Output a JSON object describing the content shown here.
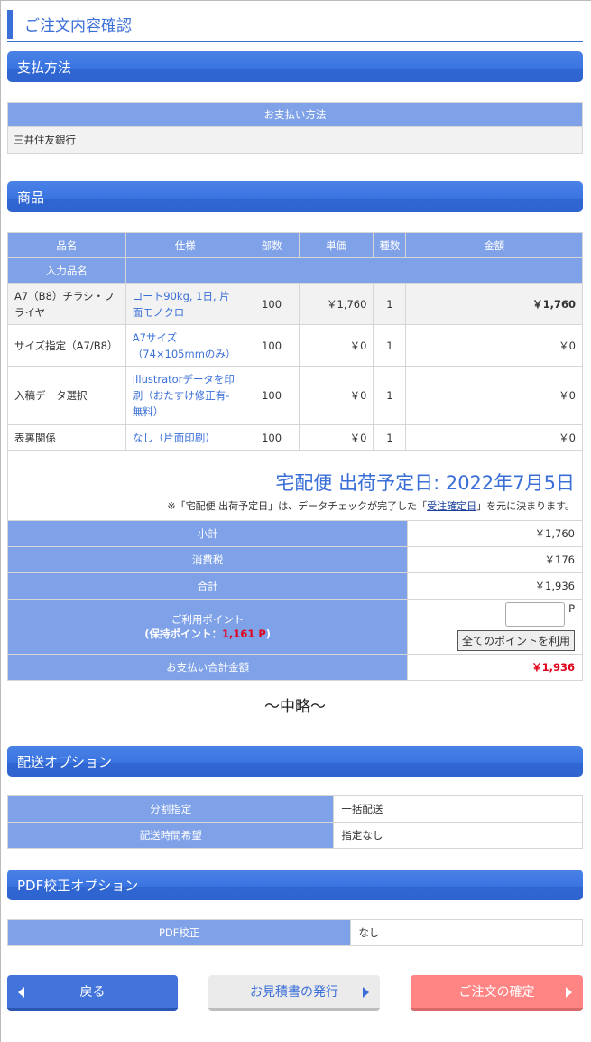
{
  "page_title": "ご注文内容確認",
  "payment": {
    "section_title": "支払方法",
    "header": "お支払い方法",
    "value": "三井住友銀行"
  },
  "products": {
    "section_title": "商品",
    "headers": [
      "品名",
      "仕様",
      "部数",
      "単価",
      "種数",
      "金額"
    ],
    "subheader": "入力品名",
    "rows": [
      {
        "name": "A7（B8）チラシ・フライヤー",
        "spec": "コート90kg, 1日, 片面モノクロ",
        "qty": "100",
        "unit": "￥1,760",
        "kinds": "1",
        "amount": "￥1,760"
      },
      {
        "name": "サイズ指定（A7/B8）",
        "spec": "A7サイズ（74×105mmのみ）",
        "qty": "100",
        "unit": "￥0",
        "kinds": "1",
        "amount": "￥0"
      },
      {
        "name": "入稿データ選択",
        "spec": "Illustratorデータを印刷（おたすけ修正有-無料）",
        "qty": "100",
        "unit": "￥0",
        "kinds": "1",
        "amount": "￥0"
      },
      {
        "name": "表裏関係",
        "spec": "なし（片面印刷）",
        "qty": "100",
        "unit": "￥0",
        "kinds": "1",
        "amount": "￥0"
      }
    ]
  },
  "shipping": {
    "title": "宅配便 出荷予定日: 2022年7月5日",
    "note_before": "※「宅配便 出荷予定日」は、データチェックが完了した「",
    "note_link": "受注確定日",
    "note_after": "」を元に決まります。"
  },
  "summary": {
    "subtotal_label": "小計",
    "subtotal": "￥1,760",
    "tax_label": "消費税",
    "tax": "￥176",
    "total_label": "合計",
    "total": "￥1,936",
    "points_label": "ご利用ポイント",
    "points_held_prefix": "(保持ポイント：",
    "points_held_value": "1,161 P",
    "points_held_suffix": ")",
    "points_unit": "P",
    "points_input_value": "",
    "use_all_button": "全てのポイントを利用",
    "payment_total_label": "お支払い合計金額",
    "payment_total": "￥1,936"
  },
  "omitted_text": "～中略～",
  "delivery_options": {
    "section_title": "配送オプション",
    "rows": [
      {
        "label": "分割指定",
        "value": "一括配送"
      },
      {
        "label": "配送時間希望",
        "value": "指定なし"
      }
    ]
  },
  "pdf_options": {
    "section_title": "PDF校正オプション",
    "label": "PDF校正",
    "value": "なし"
  },
  "buttons": {
    "back": "戻る",
    "quote": "お見積書の発行",
    "confirm": "ご注文の確定"
  }
}
